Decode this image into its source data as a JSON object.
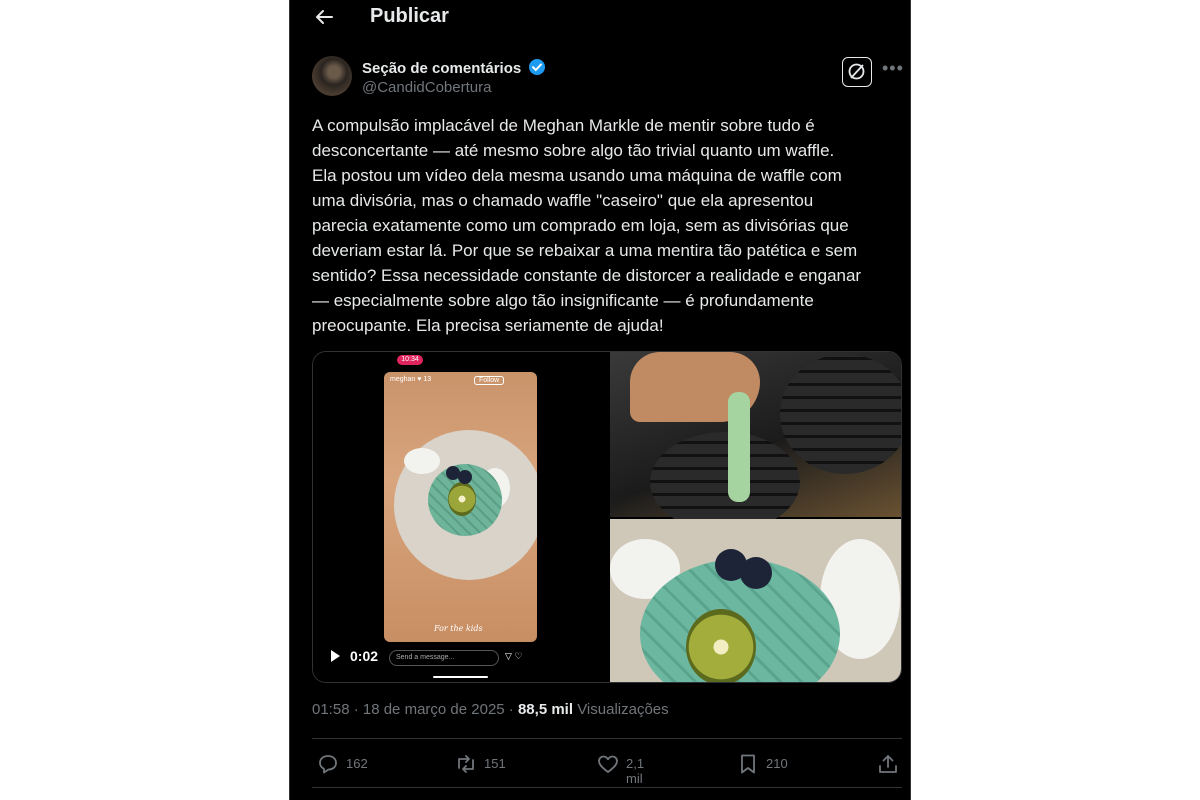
{
  "header": {
    "title": "Publicar"
  },
  "author": {
    "name": "Seção de comentários",
    "handle": "@CandidCobertura"
  },
  "tweet": {
    "text": "A compulsão implacável de Meghan Markle de mentir sobre tudo é\ndesconcertante — até mesmo sobre algo tão trivial quanto um waffle.\nEla postou um vídeo dela mesma usando uma máquina de waffle com\numa divisória, mas o chamado waffle \"caseiro\" que ela apresentou\nparecia exatamente como um comprado em loja, sem as divisórias que\ndeveriam estar lá. Por que se rebaixar a uma mentira tão patética e sem\nsentido? Essa necessidade constante de distorcer a realidade e enganar\n— especialmente sobre algo tão insignificante — é profundamente\npreocupante. Ela precisa seriamente de ajuda!"
  },
  "video": {
    "duration": "0:02",
    "phone_time": "10:34",
    "story_user": "meghan ♥ 13",
    "follow_label": "Follow",
    "caption": "For the kids",
    "message_placeholder": "Send a message..."
  },
  "meta": {
    "datetime": "01:58 · 18 de março de 2025 · ",
    "views_count": "88,5 mil",
    "views_label": "Visualizações"
  },
  "actions": {
    "replies": "162",
    "reposts": "151",
    "likes": "2,1 mil",
    "bookmarks": "210"
  },
  "colors": {
    "background": "#000000",
    "text": "#e7e9ea",
    "muted": "#71767b",
    "verified": "#1d9bf0"
  }
}
